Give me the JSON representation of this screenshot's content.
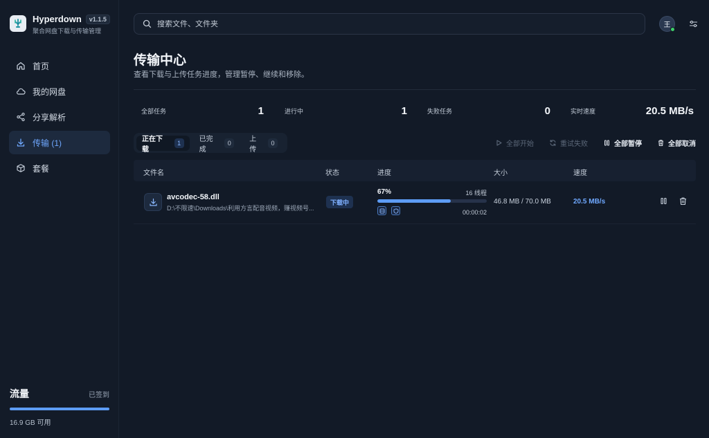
{
  "brand": {
    "name": "Hyperdown",
    "version": "v1.1.5",
    "subtitle": "聚合网盘下载与传输管理"
  },
  "sidebar": {
    "items": [
      {
        "label": "首页",
        "icon": "home-icon"
      },
      {
        "label": "我的网盘",
        "icon": "cloud-icon"
      },
      {
        "label": "分享解析",
        "icon": "share-icon"
      },
      {
        "label": "传输 (1)",
        "icon": "download-icon",
        "active": true
      },
      {
        "label": "套餐",
        "icon": "package-icon"
      }
    ]
  },
  "flow": {
    "title": "流量",
    "status": "已签到",
    "available": "16.9 GB 可用",
    "fill_percent": 100
  },
  "search": {
    "placeholder": "搜索文件、文件夹"
  },
  "user": {
    "avatar_text": "王"
  },
  "page": {
    "title": "传输中心",
    "subtitle": "查看下载与上传任务进度，管理暂停、继续和移除。"
  },
  "stats": [
    {
      "label": "全部任务",
      "value": "1"
    },
    {
      "label": "进行中",
      "value": "1"
    },
    {
      "label": "失败任务",
      "value": "0"
    },
    {
      "label": "实时速度",
      "value": "20.5 MB/s"
    }
  ],
  "tabs": [
    {
      "label": "正在下载",
      "count": "1",
      "active": true
    },
    {
      "label": "已完成",
      "count": "0"
    },
    {
      "label": "上传",
      "count": "0"
    }
  ],
  "actions": {
    "start_all": "全部开始",
    "retry_failed": "重试失败",
    "pause_all": "全部暂停",
    "cancel_all": "全部取消"
  },
  "table": {
    "headers": {
      "name": "文件名",
      "status": "状态",
      "progress": "进度",
      "size": "大小",
      "speed": "速度"
    },
    "rows": [
      {
        "name": "avcodec-58.dll",
        "path": "D:\\不限速\\Downloads\\利用方言配音视频，赚视频号...",
        "status": "下载中",
        "percent_text": "67%",
        "percent": 67,
        "threads": "16 线程",
        "elapsed": "00:00:02",
        "size": "46.8 MB / 70.0 MB",
        "speed": "20.5 MB/s"
      }
    ]
  },
  "colors": {
    "accent": "#5d9cf5",
    "accent_text": "#6fa8ff",
    "background": "#121a27"
  }
}
